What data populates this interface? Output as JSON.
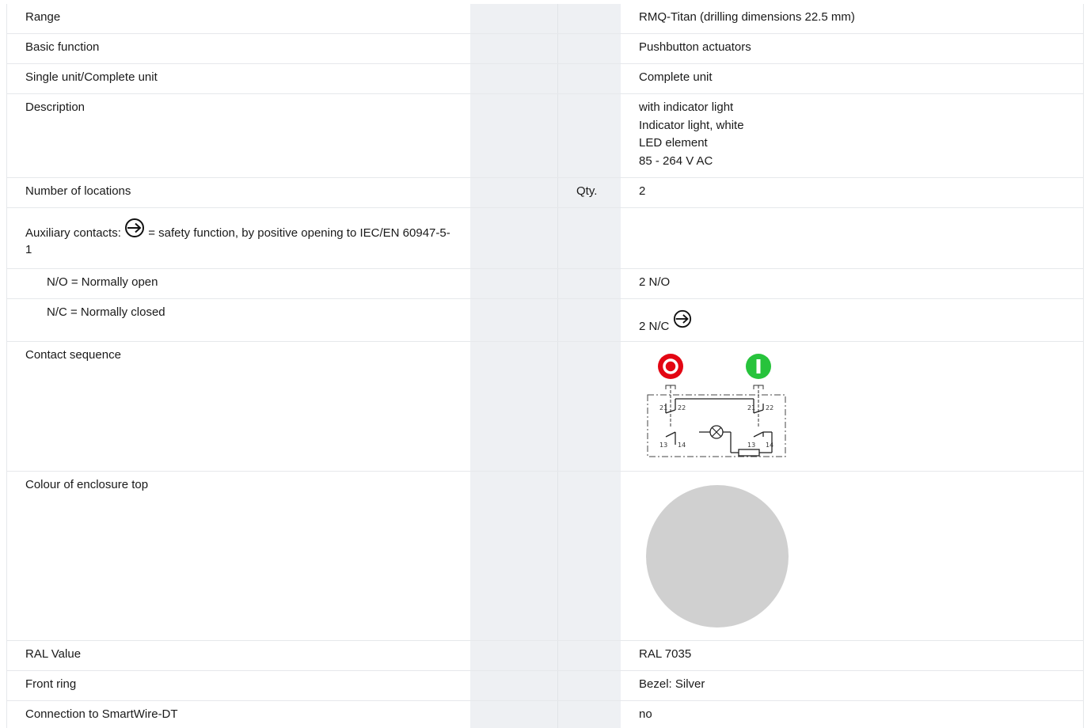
{
  "rows": {
    "range": {
      "label": "Range",
      "value": "RMQ-Titan (drilling dimensions 22.5 mm)"
    },
    "basic_function": {
      "label": "Basic function",
      "value": "Pushbutton actuators"
    },
    "single_complete": {
      "label": "Single unit/Complete unit",
      "value": "Complete unit"
    },
    "description": {
      "label": "Description",
      "lines": [
        "with indicator light",
        "Indicator light, white",
        "LED element",
        "85 - 264 V AC"
      ]
    },
    "locations": {
      "label": "Number of locations",
      "unit": "Qty.",
      "value": "2"
    },
    "aux_contacts": {
      "label_prefix": "Auxiliary contacts:",
      "label_suffix": "= safety function, by positive opening to IEC/EN 60947-5-1",
      "icon": "positive-opening-icon"
    },
    "no": {
      "label": "N/O = Normally open",
      "value": "2 N/O"
    },
    "nc": {
      "label": "N/C = Normally closed",
      "value": "2 N/C",
      "icon": "positive-opening-icon"
    },
    "contact_sequence": {
      "label": "Contact sequence",
      "diagram": {
        "stop_button_color": "#e30613",
        "start_button_color": "#27c33c",
        "terminal_labels": [
          "21",
          "22",
          "21",
          "22",
          "13",
          "14",
          "13",
          "14"
        ]
      }
    },
    "enclosure_colour": {
      "label": "Colour of enclosure top",
      "swatch_color": "#d0d0d0"
    },
    "ral": {
      "label": "RAL Value",
      "value": "RAL 7035"
    },
    "front_ring": {
      "label": "Front ring",
      "value": "Bezel: Silver"
    },
    "smartwire": {
      "label": "Connection to SmartWire-DT",
      "value": "no"
    }
  }
}
